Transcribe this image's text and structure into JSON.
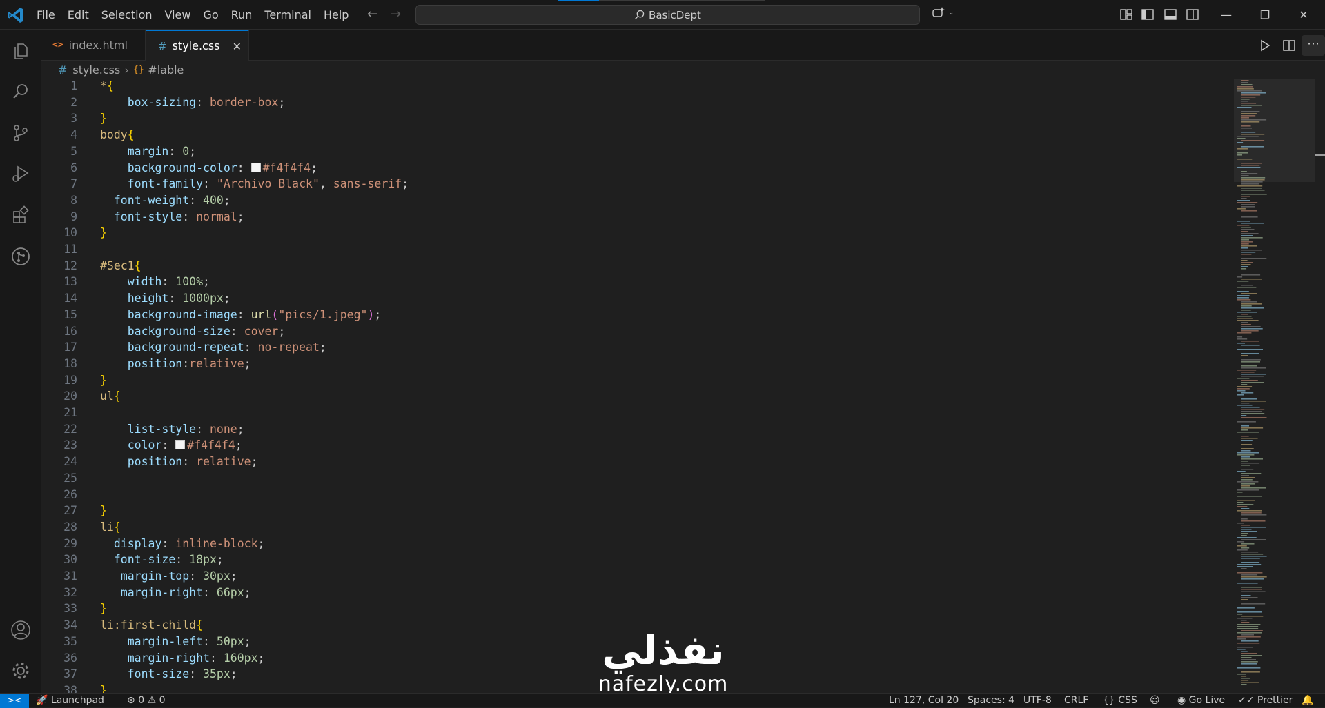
{
  "menu": [
    "File",
    "Edit",
    "Selection",
    "View",
    "Go",
    "Run",
    "Terminal",
    "Help"
  ],
  "command_center": {
    "label": "BasicDept"
  },
  "tabs": [
    {
      "label": "index.html",
      "icon": "html-file-icon"
    },
    {
      "label": "style.css",
      "icon": "css-file-icon",
      "active": true
    }
  ],
  "breadcrumb": {
    "file": "style.css",
    "symbol": "#lable"
  },
  "code": [
    {
      "n": "1",
      "segs": [
        [
          "*",
          "sel"
        ],
        [
          "{",
          "brace"
        ]
      ]
    },
    {
      "n": "2",
      "segs": [
        [
          "    ",
          "punc"
        ],
        [
          "box-sizing",
          "prop"
        ],
        [
          ": ",
          "punc"
        ],
        [
          "border-box",
          "val"
        ],
        [
          ";",
          "punc"
        ]
      ]
    },
    {
      "n": "3",
      "segs": [
        [
          "}",
          "brace"
        ]
      ]
    },
    {
      "n": "4",
      "segs": [
        [
          "body",
          "sel"
        ],
        [
          "{",
          "brace"
        ]
      ]
    },
    {
      "n": "5",
      "segs": [
        [
          "    ",
          "punc"
        ],
        [
          "margin",
          "prop"
        ],
        [
          ": ",
          "punc"
        ],
        [
          "0",
          "num"
        ],
        [
          ";",
          "punc"
        ]
      ]
    },
    {
      "n": "6",
      "segs": [
        [
          "    ",
          "punc"
        ],
        [
          "background-color",
          "prop"
        ],
        [
          ": ",
          "punc"
        ],
        [
          "",
          "swatch"
        ],
        [
          "#f4f4f4",
          "val"
        ],
        [
          ";",
          "punc"
        ]
      ]
    },
    {
      "n": "7",
      "segs": [
        [
          "    ",
          "punc"
        ],
        [
          "font-family",
          "prop"
        ],
        [
          ": ",
          "punc"
        ],
        [
          "\"Archivo Black\"",
          "str"
        ],
        [
          ", ",
          "punc"
        ],
        [
          "sans-serif",
          "val"
        ],
        [
          ";",
          "punc"
        ]
      ]
    },
    {
      "n": "8",
      "segs": [
        [
          "  ",
          "punc"
        ],
        [
          "font-weight",
          "prop"
        ],
        [
          ": ",
          "punc"
        ],
        [
          "400",
          "num"
        ],
        [
          ";",
          "punc"
        ]
      ]
    },
    {
      "n": "9",
      "segs": [
        [
          "  ",
          "punc"
        ],
        [
          "font-style",
          "prop"
        ],
        [
          ": ",
          "punc"
        ],
        [
          "normal",
          "val"
        ],
        [
          ";",
          "punc"
        ]
      ]
    },
    {
      "n": "10",
      "segs": [
        [
          "}",
          "brace"
        ]
      ]
    },
    {
      "n": "11",
      "segs": []
    },
    {
      "n": "12",
      "segs": [
        [
          "#Sec1",
          "sel"
        ],
        [
          "{",
          "brace"
        ]
      ]
    },
    {
      "n": "13",
      "segs": [
        [
          "    ",
          "punc"
        ],
        [
          "width",
          "prop"
        ],
        [
          ": ",
          "punc"
        ],
        [
          "100%",
          "num"
        ],
        [
          ";",
          "punc"
        ]
      ]
    },
    {
      "n": "14",
      "segs": [
        [
          "    ",
          "punc"
        ],
        [
          "height",
          "prop"
        ],
        [
          ": ",
          "punc"
        ],
        [
          "1000px",
          "num"
        ],
        [
          ";",
          "punc"
        ]
      ]
    },
    {
      "n": "15",
      "segs": [
        [
          "    ",
          "punc"
        ],
        [
          "background-image",
          "prop"
        ],
        [
          ": ",
          "punc"
        ],
        [
          "url",
          "fn"
        ],
        [
          "(",
          "paren"
        ],
        [
          "\"pics/1.jpeg\"",
          "str"
        ],
        [
          ")",
          "paren"
        ],
        [
          ";",
          "punc"
        ]
      ]
    },
    {
      "n": "16",
      "segs": [
        [
          "    ",
          "punc"
        ],
        [
          "background-size",
          "prop"
        ],
        [
          ": ",
          "punc"
        ],
        [
          "cover",
          "val"
        ],
        [
          ";",
          "punc"
        ]
      ]
    },
    {
      "n": "17",
      "segs": [
        [
          "    ",
          "punc"
        ],
        [
          "background-repeat",
          "prop"
        ],
        [
          ": ",
          "punc"
        ],
        [
          "no-repeat",
          "val"
        ],
        [
          ";",
          "punc"
        ]
      ]
    },
    {
      "n": "18",
      "segs": [
        [
          "    ",
          "punc"
        ],
        [
          "position",
          "prop"
        ],
        [
          ":",
          "punc"
        ],
        [
          "relative",
          "val"
        ],
        [
          ";",
          "punc"
        ]
      ]
    },
    {
      "n": "19",
      "segs": [
        [
          "}",
          "brace"
        ]
      ]
    },
    {
      "n": "20",
      "segs": [
        [
          "ul",
          "sel"
        ],
        [
          "{",
          "brace"
        ]
      ]
    },
    {
      "n": "21",
      "segs": []
    },
    {
      "n": "22",
      "segs": [
        [
          "    ",
          "punc"
        ],
        [
          "list-style",
          "prop"
        ],
        [
          ": ",
          "punc"
        ],
        [
          "none",
          "val"
        ],
        [
          ";",
          "punc"
        ]
      ]
    },
    {
      "n": "23",
      "segs": [
        [
          "    ",
          "punc"
        ],
        [
          "color",
          "prop"
        ],
        [
          ": ",
          "punc"
        ],
        [
          "",
          "swatch"
        ],
        [
          "#f4f4f4",
          "val"
        ],
        [
          ";",
          "punc"
        ]
      ]
    },
    {
      "n": "24",
      "segs": [
        [
          "    ",
          "punc"
        ],
        [
          "position",
          "prop"
        ],
        [
          ": ",
          "punc"
        ],
        [
          "relative",
          "val"
        ],
        [
          ";",
          "punc"
        ]
      ]
    },
    {
      "n": "25",
      "segs": []
    },
    {
      "n": "26",
      "segs": []
    },
    {
      "n": "27",
      "segs": [
        [
          "}",
          "brace"
        ]
      ]
    },
    {
      "n": "28",
      "segs": [
        [
          "li",
          "sel"
        ],
        [
          "{",
          "brace"
        ]
      ]
    },
    {
      "n": "29",
      "segs": [
        [
          "  ",
          "punc"
        ],
        [
          "display",
          "prop"
        ],
        [
          ": ",
          "punc"
        ],
        [
          "inline-block",
          "val"
        ],
        [
          ";",
          "punc"
        ]
      ]
    },
    {
      "n": "30",
      "segs": [
        [
          "  ",
          "punc"
        ],
        [
          "font-size",
          "prop"
        ],
        [
          ": ",
          "punc"
        ],
        [
          "18px",
          "num"
        ],
        [
          ";",
          "punc"
        ]
      ]
    },
    {
      "n": "31",
      "segs": [
        [
          "   ",
          "punc"
        ],
        [
          "margin-top",
          "prop"
        ],
        [
          ": ",
          "punc"
        ],
        [
          "30px",
          "num"
        ],
        [
          ";",
          "punc"
        ]
      ]
    },
    {
      "n": "32",
      "segs": [
        [
          "   ",
          "punc"
        ],
        [
          "margin-right",
          "prop"
        ],
        [
          ": ",
          "punc"
        ],
        [
          "66px",
          "num"
        ],
        [
          ";",
          "punc"
        ]
      ]
    },
    {
      "n": "33",
      "segs": [
        [
          "}",
          "brace"
        ]
      ]
    },
    {
      "n": "34",
      "segs": [
        [
          "li:first-child",
          "sel"
        ],
        [
          "{",
          "brace"
        ]
      ]
    },
    {
      "n": "35",
      "segs": [
        [
          "    ",
          "punc"
        ],
        [
          "margin-left",
          "prop"
        ],
        [
          ": ",
          "punc"
        ],
        [
          "50px",
          "num"
        ],
        [
          ";",
          "punc"
        ]
      ]
    },
    {
      "n": "36",
      "segs": [
        [
          "    ",
          "punc"
        ],
        [
          "margin-right",
          "prop"
        ],
        [
          ": ",
          "punc"
        ],
        [
          "160px",
          "num"
        ],
        [
          ";",
          "punc"
        ]
      ]
    },
    {
      "n": "37",
      "segs": [
        [
          "    ",
          "punc"
        ],
        [
          "font-size",
          "prop"
        ],
        [
          ": ",
          "punc"
        ],
        [
          "35px",
          "num"
        ],
        [
          ";",
          "punc"
        ]
      ]
    },
    {
      "n": "38",
      "segs": [
        [
          "}",
          "brace"
        ]
      ]
    }
  ],
  "watermark": {
    "logo": "نفذلي",
    "url": "nafezly.com"
  },
  "status": {
    "launchpad": "Launchpad",
    "errors": "0",
    "warnings": "0",
    "position": "Ln 127, Col 20",
    "spaces": "Spaces: 4",
    "encoding": "UTF-8",
    "eol": "CRLF",
    "language": "CSS",
    "golive": "Go Live",
    "prettier": "Prettier"
  },
  "colors": {
    "accent": "#0078d4",
    "editor_bg": "#1f1f1f",
    "chrome_bg": "#181818",
    "selector": "#d7ba7d",
    "property": "#9cdcfe",
    "value": "#ce9178",
    "number": "#b5cea8",
    "bracket": "#ffd700"
  }
}
